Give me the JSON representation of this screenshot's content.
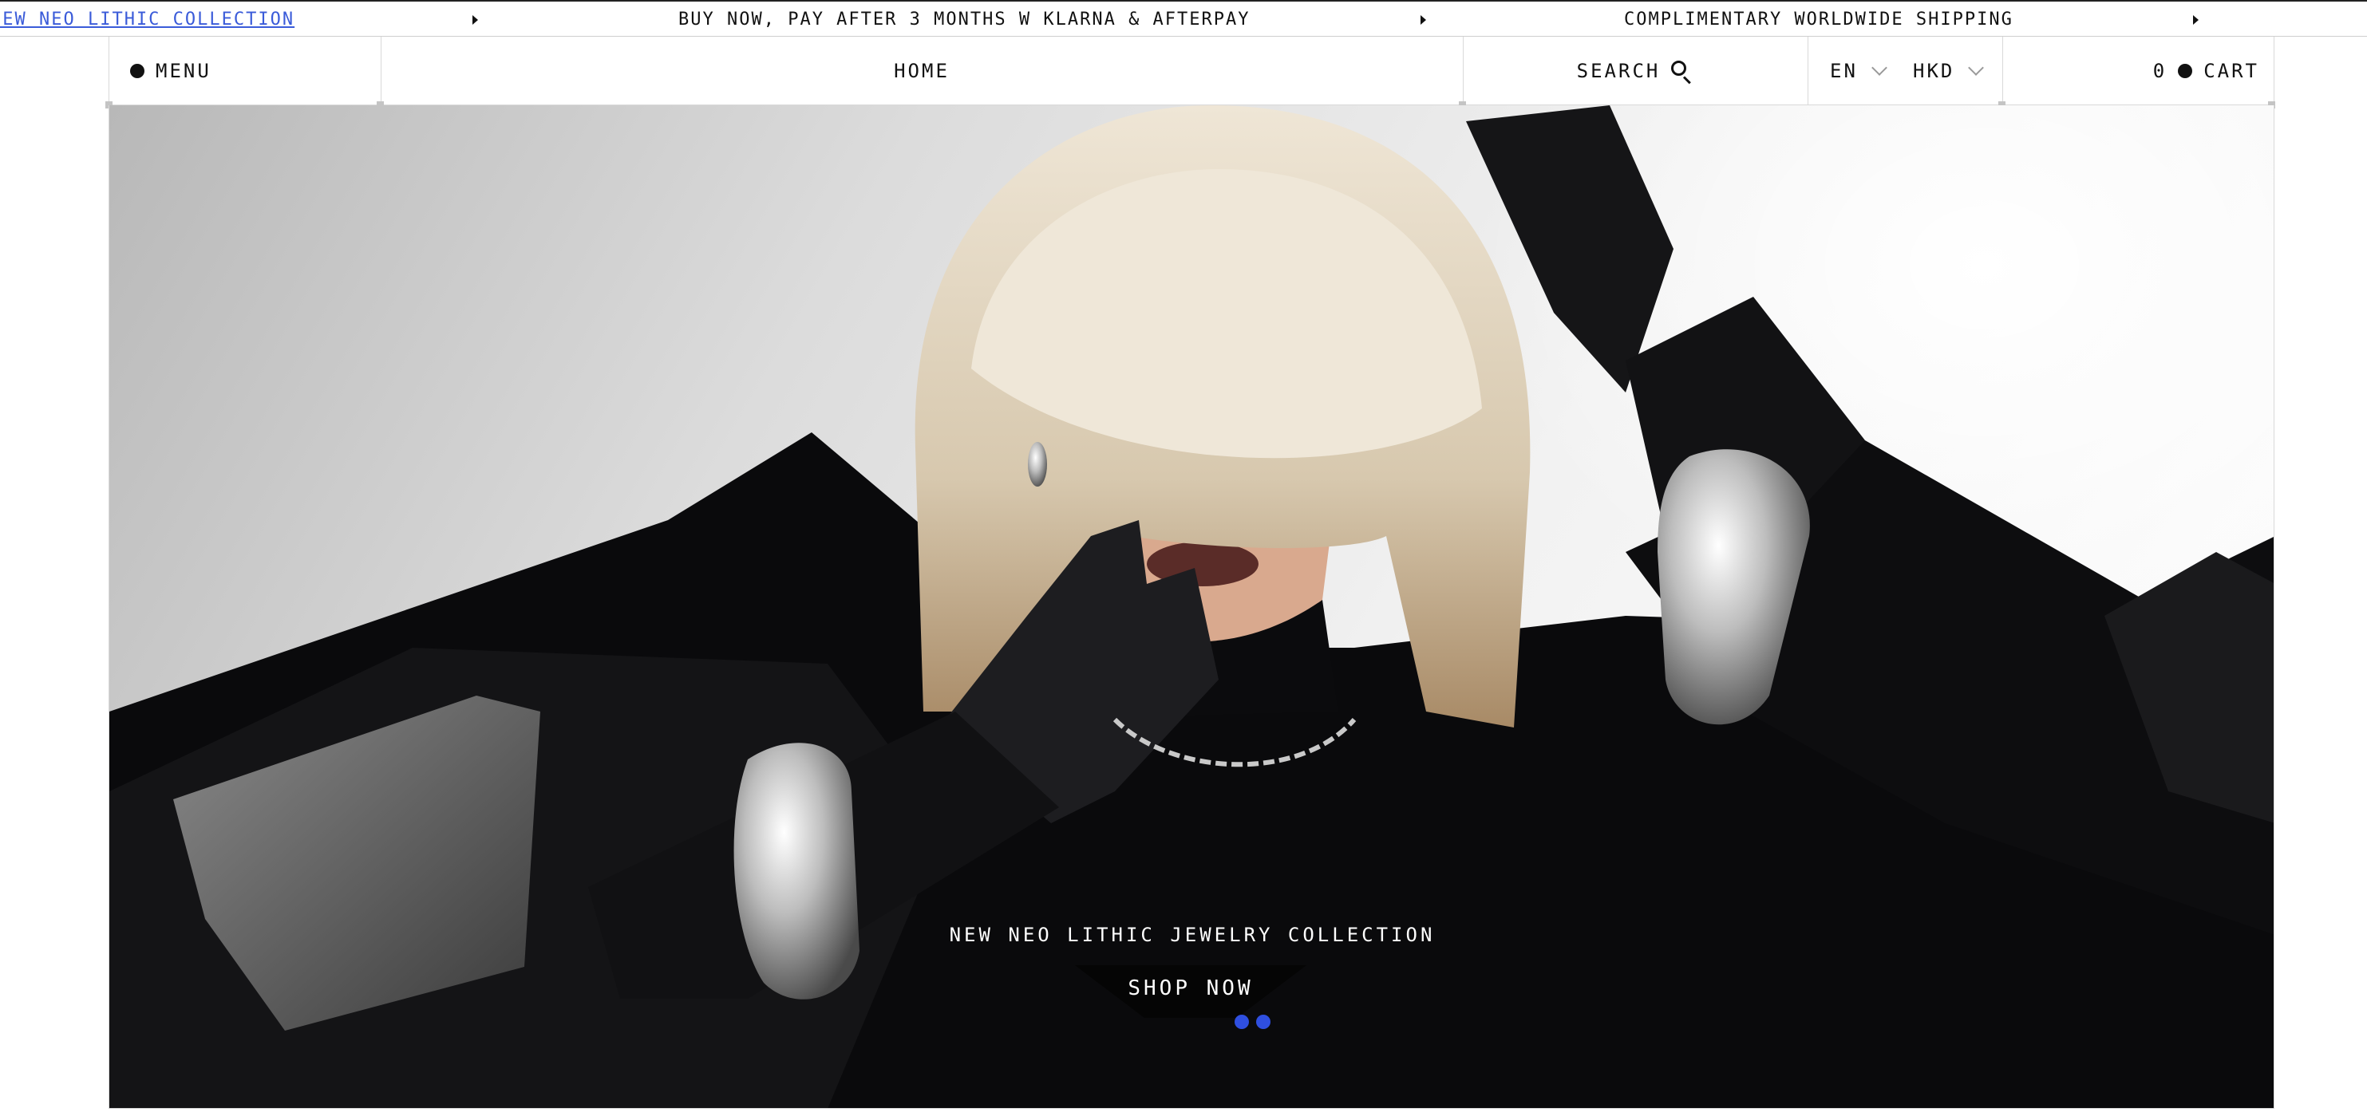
{
  "announcements": [
    {
      "text": "NEW NEO LITHIC COLLECTION",
      "is_link": true
    },
    {
      "text": "BUY NOW, PAY AFTER 3 MONTHS W KLARNA & AFTERPAY",
      "is_link": false
    },
    {
      "text": "COMPLIMENTARY WORLDWIDE SHIPPING",
      "is_link": false
    }
  ],
  "header": {
    "menu_label": "MENU",
    "home_label": "HOME",
    "search_label": "SEARCH",
    "language": "EN",
    "currency": "HKD",
    "cart_count": "0",
    "cart_label": "CART"
  },
  "hero": {
    "caption": "NEW NEO LITHIC JEWELRY COLLECTION",
    "cta_label": "SHOP NOW",
    "slide_count": 2,
    "active_slide": 1
  },
  "colors": {
    "link": "#3a5bd9",
    "carousel_dot": "#2f4fe0",
    "text": "#111111"
  },
  "icons": [
    "menu-dot-icon",
    "search-icon",
    "chevron-down-icon",
    "cart-dot-icon",
    "chevron-right-icon"
  ]
}
